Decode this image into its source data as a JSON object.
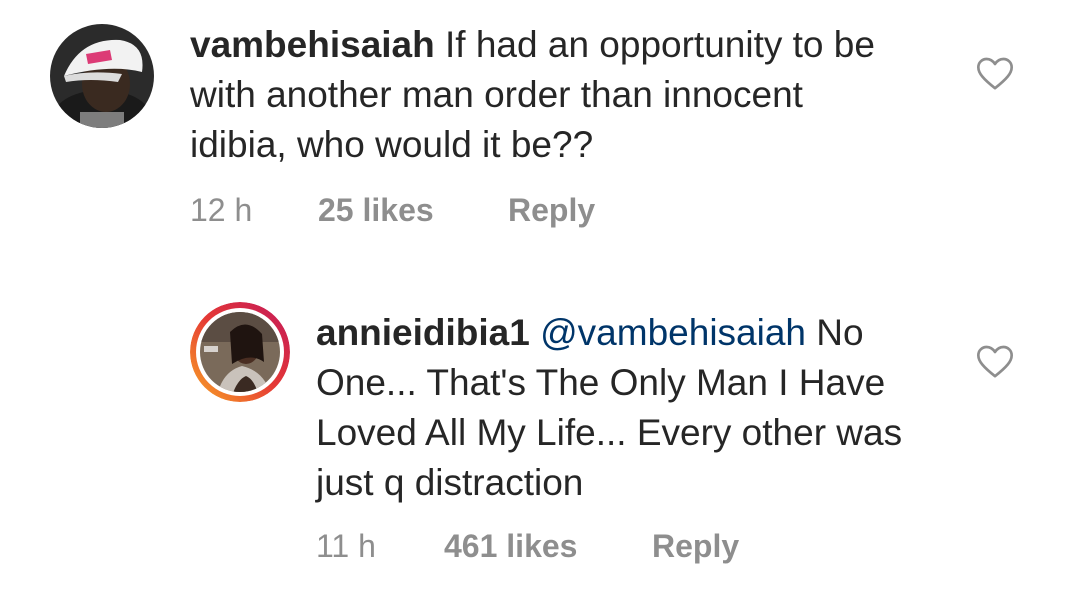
{
  "comments": [
    {
      "username": "vambehisaiah",
      "mention": "",
      "text": "If had an opportunity to be with another man order than innocent idibia, who would it be??",
      "time": "12 h",
      "likes": "25 likes",
      "reply_label": "Reply",
      "avatar_icon": "avatar-photo-cap",
      "heart_icon": "heart-outline-icon"
    },
    {
      "username": "annieidibia1",
      "mention": "@vambehisaiah",
      "text": "No One... That's The Only Man I Have Loved All My Life... Every other was just q distraction",
      "time": "11 h",
      "likes": "461 likes",
      "reply_label": "Reply",
      "avatar_icon": "avatar-photo-story-ring",
      "heart_icon": "heart-outline-icon"
    }
  ],
  "colors": {
    "text": "#262626",
    "meta": "#8e8e8e",
    "mention": "#003569",
    "story_ring_start": "#f9a825",
    "story_ring_end": "#c2185b"
  }
}
